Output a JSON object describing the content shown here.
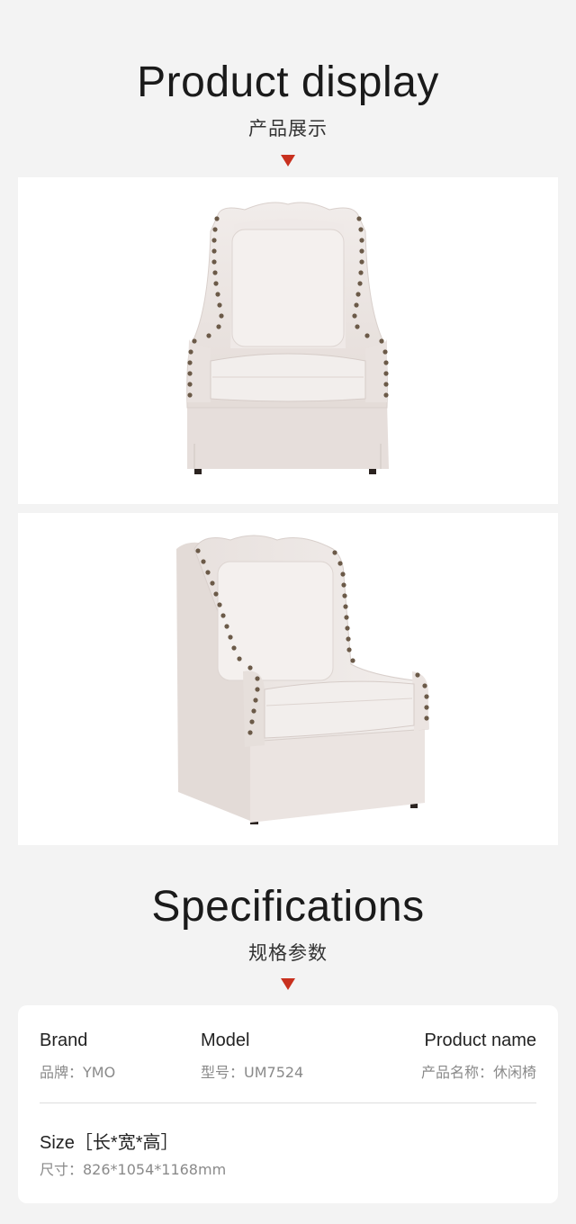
{
  "product_display": {
    "title": "Product display",
    "subtitle": "产品展示"
  },
  "gallery": {
    "images": [
      {
        "alt": "wingback-armchair-front-view"
      },
      {
        "alt": "wingback-armchair-angled-view"
      }
    ]
  },
  "specifications": {
    "title": "Specifications",
    "subtitle": "规格参数",
    "brand": {
      "label": "Brand",
      "value": "品牌：YMO"
    },
    "model": {
      "label": "Model",
      "value": "型号：UM7524"
    },
    "product_name": {
      "label": "Product name",
      "value": "产品名称：休闲椅"
    },
    "size": {
      "label": "Size［长*宽*高］",
      "value": "尺寸：826*1054*1168mm"
    }
  },
  "colors": {
    "accent_arrow": "#c8301e",
    "fabric": "#ece6e3",
    "nailhead": "#6b5a48",
    "background": "#f3f3f3"
  }
}
